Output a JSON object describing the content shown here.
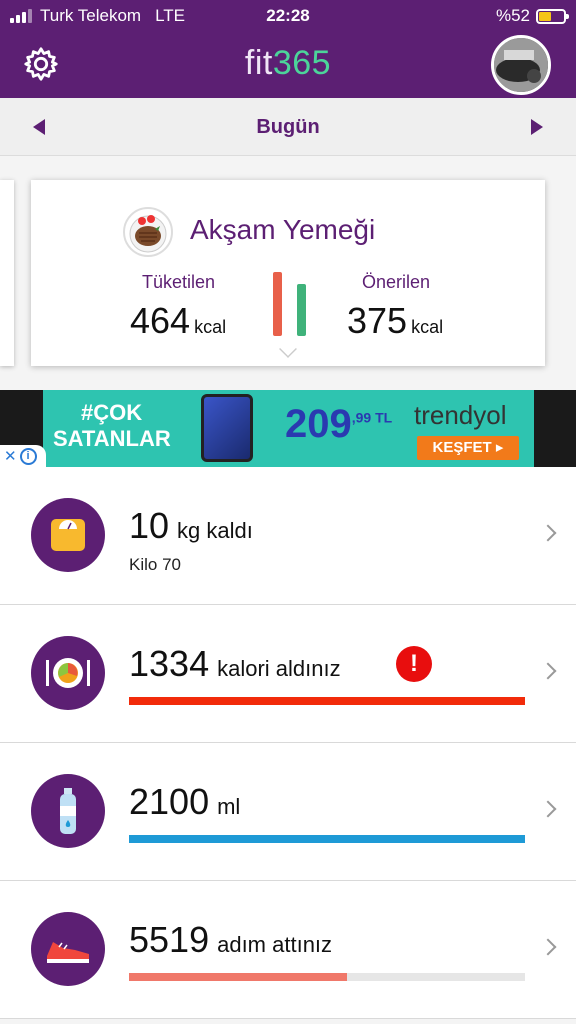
{
  "status_bar": {
    "carrier": "Turk Telekom",
    "network": "LTE",
    "time": "22:28",
    "battery_label": "%52",
    "battery_level": 0.52
  },
  "header": {
    "logo_part1": "fit",
    "logo_part2": "365",
    "settings_icon": "gear-icon",
    "avatar_icon": "avatar"
  },
  "date_nav": {
    "label": "Bugün",
    "prev_icon": "triangle-left-icon",
    "next_icon": "triangle-right-icon"
  },
  "meal_card": {
    "title": "Akşam Yemeği",
    "icon": "steak-plate-icon",
    "consumed_label": "Tüketilen",
    "consumed_value": "464",
    "consumed_unit": "kcal",
    "recommended_label": "Önerilen",
    "recommended_value": "375",
    "recommended_unit": "kcal",
    "colors": {
      "consumed": "#e8604a",
      "recommended": "#3fb27a"
    }
  },
  "ad": {
    "tag_line1": "#ÇOK",
    "tag_line2": "SATANLAR",
    "price": "209",
    "price_cents": ",99",
    "currency": "TL",
    "brand": "trendyol",
    "cta": "KEŞFET",
    "close_icon": "close-icon",
    "info_icon": "info-icon"
  },
  "list": [
    {
      "value": "10",
      "unit": "kg kaldı",
      "subtitle": "Kilo 70",
      "icon": "scale-icon"
    },
    {
      "value": "1334",
      "unit": "kalori aldınız",
      "icon": "plate-icon",
      "alert": "!",
      "progress": 1.0,
      "color": "#f22b0a"
    },
    {
      "value": "2100",
      "unit": "ml",
      "icon": "water-bottle-icon",
      "progress": 1.0,
      "color": "#1e9ad6"
    },
    {
      "value": "5519",
      "unit": "adım attınız",
      "icon": "sneaker-icon",
      "progress": 0.55,
      "color": "#f0786a"
    }
  ],
  "colors": {
    "primary": "#5c1f73",
    "logo_accent": "#4cd49a"
  }
}
